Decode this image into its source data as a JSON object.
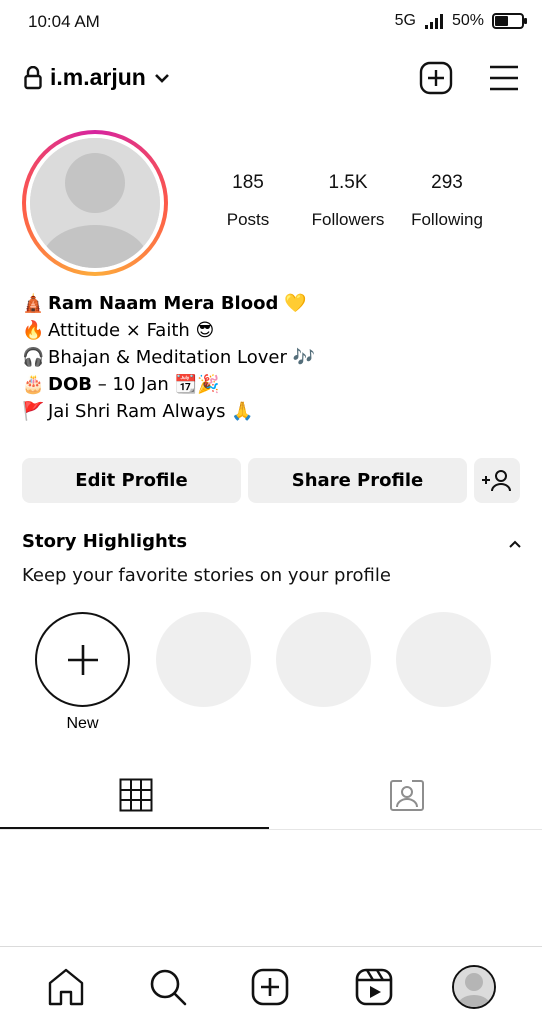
{
  "status_bar": {
    "time": "10:04 AM",
    "network": "5G",
    "battery": "50%",
    "battery_level": 0.5
  },
  "header": {
    "username": "i.m.arjun"
  },
  "stats": [
    {
      "value": "185",
      "label": "Posts"
    },
    {
      "value": "1.5K",
      "label": "Followers"
    },
    {
      "value": "293",
      "label": "Following"
    }
  ],
  "bio": {
    "line1_emoji": "🛕",
    "line1_text": "Ram Naam Mera Blood",
    "line1_end": "💛",
    "line2_emoji": "🔥",
    "line2_text": "Attitude × Faith",
    "line2_end": "😎",
    "line3_emoji": "🎧",
    "line3_text": "Bhajan & Meditation Lover",
    "line3_end": "🎶",
    "line4_emoji": "🎂",
    "line4_bold": "DOB",
    "line4_text": " – 10 Jan",
    "line4_end": "📆🎉",
    "line5_emoji": "🚩",
    "line5_text": "Jai Shri Ram Always",
    "line5_end": "🙏"
  },
  "buttons": {
    "edit": "Edit Profile",
    "share": "Share Profile"
  },
  "highlights": {
    "title": "Story Highlights",
    "subtitle": "Keep your favorite stories on your profile",
    "new_label": "New"
  },
  "icons": {
    "lock": "lock-icon",
    "chevron": "chevron-down-icon",
    "create": "plus-square-icon",
    "menu": "hamburger-menu-icon",
    "add_person": "add-person-icon",
    "collapse": "chevron-up-icon",
    "grid": "grid-icon",
    "tagged": "tagged-icon",
    "home": "home-icon",
    "search": "search-icon",
    "reels": "reels-icon"
  },
  "colors": {
    "button_bg": "#efefef",
    "placeholder": "#efefef",
    "text": "#000000"
  }
}
